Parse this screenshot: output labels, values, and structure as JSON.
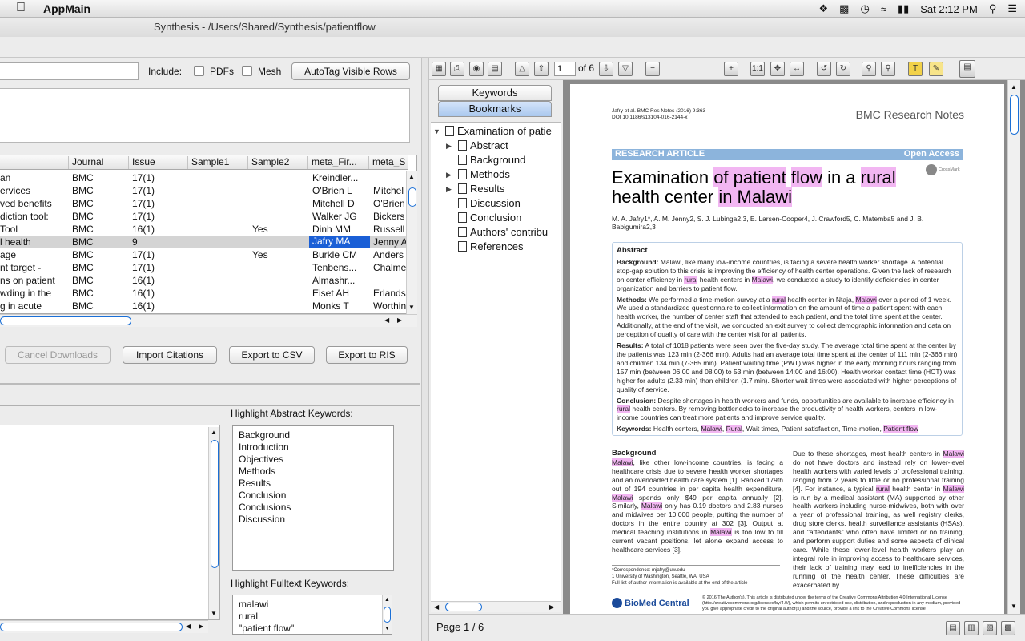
{
  "menubar": {
    "app_name": "AppMain",
    "clock": "Sat 2:12 PM"
  },
  "window": {
    "title": "Synthesis - /Users/Shared/Synthesis/patientflow"
  },
  "filters": {
    "include_label": "Include:",
    "pdfs_label": "PDFs",
    "mesh_label": "Mesh",
    "autotag_label": "AutoTag Visible Rows",
    "search_value": ""
  },
  "table": {
    "columns": [
      "Journal",
      "Issue",
      "Sample1",
      "Sample2",
      "meta_Fir...",
      "meta_S"
    ],
    "rows": [
      {
        "title": " an",
        "journal": "BMC",
        "issue": "17(1)",
        "sample1": "",
        "sample2": "",
        "meta_first": "Kreindler...",
        "meta_s": ""
      },
      {
        "title": "ervices",
        "journal": "BMC",
        "issue": "17(1)",
        "sample1": "",
        "sample2": "",
        "meta_first": "O'Brien L",
        "meta_s": "Mitchel"
      },
      {
        "title": "ved benefits",
        "journal": "BMC",
        "issue": "17(1)",
        "sample1": "",
        "sample2": "",
        "meta_first": "Mitchell D",
        "meta_s": "O'Brien"
      },
      {
        "title": "diction tool:",
        "journal": "BMC",
        "issue": "17(1)",
        "sample1": "",
        "sample2": "",
        "meta_first": "Walker JG",
        "meta_s": "Bickers"
      },
      {
        "title": " Tool",
        "journal": "BMC",
        "issue": "16(1)",
        "sample1": "",
        "sample2": "Yes",
        "meta_first": "Dinh MM",
        "meta_s": "Russell"
      },
      {
        "title": "l health",
        "journal": "BMC",
        "issue": "9",
        "sample1": "",
        "sample2": "",
        "meta_first": "Jafry MA",
        "meta_s": "Jenny A"
      },
      {
        "title": "age",
        "journal": "BMC",
        "issue": "17(1)",
        "sample1": "",
        "sample2": "Yes",
        "meta_first": "Burkle CM",
        "meta_s": "Anders"
      },
      {
        "title": "nt target -",
        "journal": "BMC",
        "issue": "17(1)",
        "sample1": "",
        "sample2": "",
        "meta_first": "Tenbens...",
        "meta_s": "Chalme"
      },
      {
        "title": "ns on patient",
        "journal": "BMC",
        "issue": "16(1)",
        "sample1": "",
        "sample2": "",
        "meta_first": "Almashr...",
        "meta_s": ""
      },
      {
        "title": "wding in the",
        "journal": "BMC",
        "issue": "16(1)",
        "sample1": "",
        "sample2": "",
        "meta_first": "Eiset AH",
        "meta_s": "Erlands"
      },
      {
        "title": "g in acute",
        "journal": "BMC",
        "issue": "16(1)",
        "sample1": "",
        "sample2": "",
        "meta_first": "Monks T",
        "meta_s": "Worthin"
      }
    ]
  },
  "actions": {
    "cancel_downloads": "Cancel Downloads",
    "import_citations": "Import Citations",
    "export_csv": "Export to CSV",
    "export_ris": "Export to RIS"
  },
  "keywords": {
    "abstract_label": "Highlight Abstract Keywords:",
    "abstract_items": [
      "Background",
      "Introduction",
      "Objectives",
      "Methods",
      "Results",
      "Conclusion",
      "Conclusions",
      "Discussion"
    ],
    "fulltext_label": "Highlight Fulltext Keywords:",
    "fulltext_items": [
      "malawi",
      "rural",
      "\"patient flow\""
    ]
  },
  "viewer": {
    "page_input": "1",
    "of_pages": "of 6",
    "tabs": [
      "Keywords",
      "Bookmarks"
    ],
    "bookmarks": [
      {
        "label": "Examination of patie",
        "expandable": true,
        "expanded": true,
        "level": 0
      },
      {
        "label": "Abstract",
        "expandable": true,
        "level": 1
      },
      {
        "label": "Background",
        "expandable": false,
        "level": 1
      },
      {
        "label": "Methods",
        "expandable": true,
        "level": 1
      },
      {
        "label": "Results",
        "expandable": true,
        "level": 1
      },
      {
        "label": "Discussion",
        "expandable": false,
        "level": 1
      },
      {
        "label": "Conclusion",
        "expandable": false,
        "level": 1
      },
      {
        "label": "Authors' contribu",
        "expandable": false,
        "level": 1
      },
      {
        "label": "References",
        "expandable": false,
        "level": 1
      }
    ],
    "status": "Page 1 / 6"
  },
  "pdf": {
    "citation_line1": "Jafry et al. BMC Res Notes (2016) 9:363",
    "citation_line2": "DOI 10.1186/s13104-016-2144-x",
    "journal": "BMC Research Notes",
    "band_left": "RESEARCH ARTICLE",
    "band_right": "Open Access",
    "crossmark": "CrossMark",
    "title_p1": "Examination ",
    "title_p2": "of patient",
    "title_p3": " ",
    "title_p4": "flow",
    "title_p5": " in a ",
    "title_p6": "rural",
    "title_p7": "health center ",
    "title_p8": "in Malawi",
    "authors": "M. A. Jafry1*, A. M. Jenny2, S. J. Lubinga2,3, E. Larsen-Cooper4, J. Crawford5, C. Matemba5 and J. B. Babigumira2,3",
    "abstract_head": "Abstract",
    "bg_head": "Background:",
    "bg_a": "Malawi, like many low-income countries, is facing a severe health worker shortage. A potential stop-gap solution to this crisis is improving the efficiency of health center operations. Given the lack of research on center efficiency in ",
    "bg_rural": "rural",
    "bg_b": " health centers in ",
    "bg_malawi": "Malawi",
    "bg_c": ", we conducted a study to identify deficiencies in center organization and barriers to patient flow.",
    "m_head": "Methods:",
    "m_a": "We performed a time-motion survey at a ",
    "m_rural": "rural",
    "m_b": " health center in Ntaja, ",
    "m_malawi": "Malawi",
    "m_c": " over a period of 1 week. We used a standardized questionnaire to collect information on the amount of time a patient spent with each health worker, the number of center staff that attended to each patient, and the total time spent at the center. Additionally, at the end of the visit, we conducted an exit survey to collect demographic information and data on perception of quality of care with the center visit for all patients.",
    "r_head": "Results:",
    "r_text": "A total of 1018 patients were seen over the five-day study. The average total time spent at the center by the patients was 123 min (2-366 min). Adults had an average total time spent at the center of 111 min (2-366 min) and children 134 min (7-365 min). Patient waiting time (PWT) was higher in the early morning hours ranging from 157 min (between 06:00 and 08:00) to 53 min (between 14:00 and 16:00). Health worker contact time (HCT) was higher for adults (2.33 min) than children (1.7 min). Shorter wait times were associated with higher perceptions of quality of service.",
    "c_head": "Conclusion:",
    "c_a": "Despite shortages in health workers and funds, opportunities are available to increase efficiency in ",
    "c_rural": "rural",
    "c_b": " health centers. By removing bottlenecks to increase the productivity of health workers, centers in low-income countries can treat more patients and improve service quality.",
    "k_head": "Keywords:",
    "k_a": "Health centers, ",
    "k_malawi": "Malawi",
    "k_sep": ", ",
    "k_rural": "Rural",
    "k_b": ", Wait times, Patient satisfaction, Time-motion, ",
    "k_pf": "Patient flow",
    "col1_head": "Background",
    "col1_malawi1": "Malawi",
    "col1_a": ", like other low-income countries, is facing a healthcare crisis due to severe health worker shortages and an overloaded health care system [1]. Ranked 179th out of 194 countries in per capita health expenditure, ",
    "col1_malawi2": "Malawi",
    "col1_b": " spends only $49 per capita annually [2]. Similarly, ",
    "col1_malawi3": "Malawi",
    "col1_c": " only has 0.19 doctors and 2.83 nurses and midwives per 10,000 people, putting the number of doctors in the entire country at 302 [3]. Output at medical teaching institutions in ",
    "col1_malawi4": "Malawi",
    "col1_d": " is too low to fill current vacant positions, let alone expand access to healthcare services [3].",
    "col2_a": "Due to these shortages, most health centers in ",
    "col2_malawi1": "Malawi",
    "col2_b": " do not have doctors and instead rely on lower-level health workers with varied levels of professional training, ranging from 2 years to little or no professional training [4]. For instance, a typical ",
    "col2_rural": "rural",
    "col2_c": " health center in ",
    "col2_malawi2": "Malawi",
    "col2_d": " is run by a medical assistant (MA) supported by other health workers including nurse-midwives, both with over a year of professional training, as well registry clerks, drug store clerks, health surveillance assistants (HSAs), and \"attendants\" who often have limited or no training, and perform support duties and some aspects of clinical care. While these lower-level health workers play an integral role in improving access to healthcare services, their lack of training may lead to inefficiencies in the running of the health center. These difficulties are exacerbated by",
    "fn1": "*Correspondence: mjafry@uw.edu",
    "fn2": "1 University of Washington, Seattle, WA, USA",
    "fn3": "Full list of author information is available at the end of the article",
    "bmc_logo": "BioMed Central",
    "license": "© 2016 The Author(s). This article is distributed under the terms of the Creative Commons Attribution 4.0 International License (http://creativecommons.org/licenses/by/4.0/), which permits unrestricted use, distribution, and reproduction in any medium, provided you give appropriate credit to the original author(s) and the source, provide a link to the Creative Commons license"
  }
}
